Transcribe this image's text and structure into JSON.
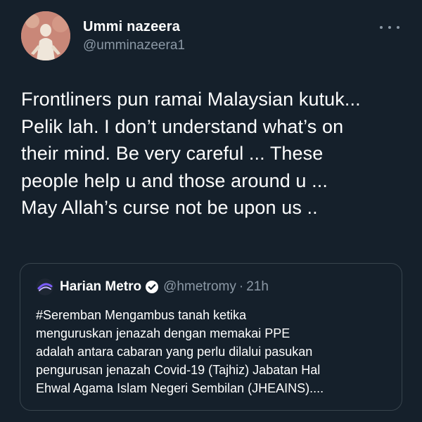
{
  "tweet": {
    "author": {
      "display_name": "Ummi nazeera",
      "handle": "@umminazeera1"
    },
    "text_lines": [
      "Frontliners pun ramai Malaysian kutuk...",
      "Pelik lah. I don’t understand what’s on",
      "their mind. Be very careful ... These",
      "people help u and those around u ...",
      "May Allah’s curse not be upon us .."
    ],
    "more_icon": "more-horizontal-icon"
  },
  "quote": {
    "author": {
      "display_name": "Harian Metro",
      "handle": "@hmetromy",
      "separator": "·",
      "time": "21h",
      "verified": true
    },
    "text_lines": [
      "#Seremban Mengambus tanah ketika",
      "menguruskan jenazah dengan memakai PPE",
      "adalah antara cabaran yang perlu dilalui pasukan",
      "pengurusan jenazah Covid-19 (Tajhiz) Jabatan Hal",
      "Ehwal Agama Islam Negeri Sembilan (JHEAINS)...."
    ]
  },
  "colors": {
    "background": "#15202b",
    "text_primary": "#ffffff",
    "text_secondary": "#8b98a5",
    "border": "#38444d"
  }
}
